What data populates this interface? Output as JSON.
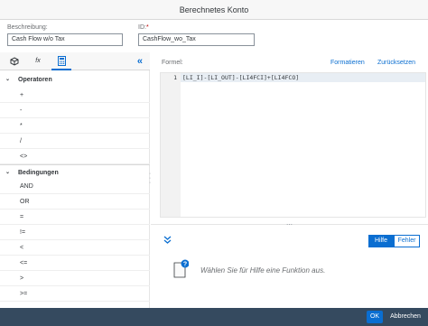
{
  "window": {
    "title": "Berechnetes Konto"
  },
  "fields": {
    "description": {
      "label": "Beschreibung:",
      "value": "Cash Flow w/o Tax"
    },
    "id": {
      "label": "ID:",
      "required_mark": "*",
      "value": "CashFlow_wo_Tax"
    }
  },
  "left_tabs": {
    "items": [
      {
        "icon": "cube-icon",
        "glyph": "⬢"
      },
      {
        "icon": "function-icon",
        "glyph": "fx"
      },
      {
        "icon": "calculator-icon",
        "glyph": "▦"
      }
    ],
    "active_index": 2,
    "collapse_glyph": "«"
  },
  "operators": {
    "title": "Operatoren",
    "items": [
      "+",
      "-",
      "*",
      "/",
      "<>"
    ]
  },
  "conditions": {
    "title": "Bedingungen",
    "items": [
      "AND",
      "OR",
      "=",
      "!=",
      "<",
      "<=",
      ">",
      ">="
    ]
  },
  "formula": {
    "label": "Formel:",
    "format_link": "Formatieren",
    "reset_link": "Zurücksetzen",
    "line_number": "1",
    "code": "[LI_I]-[LI_OUT]-[LI4FCI]+[LI4FCO]"
  },
  "help": {
    "expand_glyph": "⌄",
    "tabs": [
      "Hilfe",
      "Fehler"
    ],
    "active_tab": "Hilfe",
    "message": "Wählen Sie für Hilfe eine Funktion aus."
  },
  "footer": {
    "ok_label": "OK",
    "cancel_label": "Abbrechen"
  },
  "colors": {
    "accent": "#0a6ed1",
    "footer_bg": "#354a5f",
    "required": "#bb0000"
  }
}
